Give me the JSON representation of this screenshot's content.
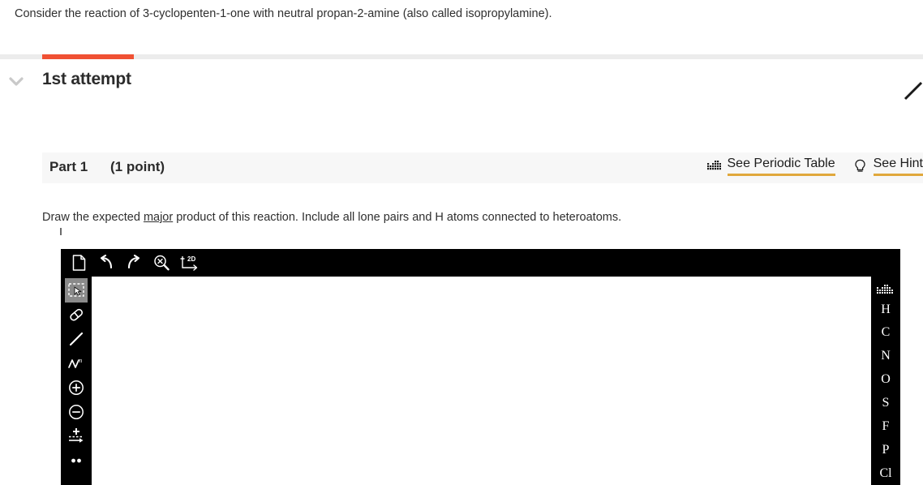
{
  "prompt": {
    "text": "Consider the reaction of 3-cyclopenten-1-one with neutral propan-2-amine (also called isopropylamine)."
  },
  "progress": {
    "fill_percent": 10,
    "fill_color": "#f05133",
    "track_color": "#ececec"
  },
  "attempt": {
    "title": "1st attempt",
    "chevron_icon": "chevron-down-icon",
    "edit_icon": "pencil-icon"
  },
  "part": {
    "label": "Part 1",
    "points": "(1 point)",
    "background": "#f7f7f7",
    "actions": [
      {
        "label": "See Periodic Table",
        "icon": "periodic-table-icon",
        "underline_color": "#e0a83c"
      },
      {
        "label": "See Hint",
        "icon": "lightbulb-icon",
        "underline_color": "#e0a83c"
      }
    ]
  },
  "instruction": {
    "before": "Draw the expected ",
    "emphasis": "major",
    "after": " product of this reaction.  Include all lone pairs and H atoms connected to heteroatoms."
  },
  "editor": {
    "background": "#000000",
    "canvas_color": "#ffffff",
    "toolbar": [
      {
        "name": "new-document",
        "icon": "document-icon",
        "active": false
      },
      {
        "name": "undo",
        "icon": "undo-arrow-icon",
        "active": false
      },
      {
        "name": "redo",
        "icon": "redo-arrow-icon",
        "active": false
      },
      {
        "name": "clear-zoom",
        "icon": "magnifier-x-icon",
        "active": false
      },
      {
        "name": "two-d-cleanup",
        "icon": "2d-axes-icon",
        "label": "2D",
        "active": false
      }
    ],
    "tools": [
      {
        "name": "select",
        "icon": "marquee-select-icon",
        "active": true
      },
      {
        "name": "eraser",
        "icon": "eraser-icon",
        "active": false
      },
      {
        "name": "single-bond",
        "icon": "bond-line-icon",
        "active": false
      },
      {
        "name": "chain",
        "icon": "zigzag-chain-icon",
        "active": false
      },
      {
        "name": "increase-charge",
        "icon": "circle-plus-icon",
        "active": false
      },
      {
        "name": "decrease-charge",
        "icon": "circle-minus-icon",
        "active": false
      },
      {
        "name": "reaction-arrow",
        "icon": "plus-arrow-icon",
        "active": false
      },
      {
        "name": "lone-pair",
        "icon": "two-dots-icon",
        "active": false
      }
    ],
    "elements": [
      {
        "symbol": "H"
      },
      {
        "symbol": "C"
      },
      {
        "symbol": "N"
      },
      {
        "symbol": "O"
      },
      {
        "symbol": "S"
      },
      {
        "symbol": "F"
      },
      {
        "symbol": "P"
      },
      {
        "symbol": "Cl"
      }
    ],
    "periodic_table_icon": "periodic-table-icon"
  }
}
